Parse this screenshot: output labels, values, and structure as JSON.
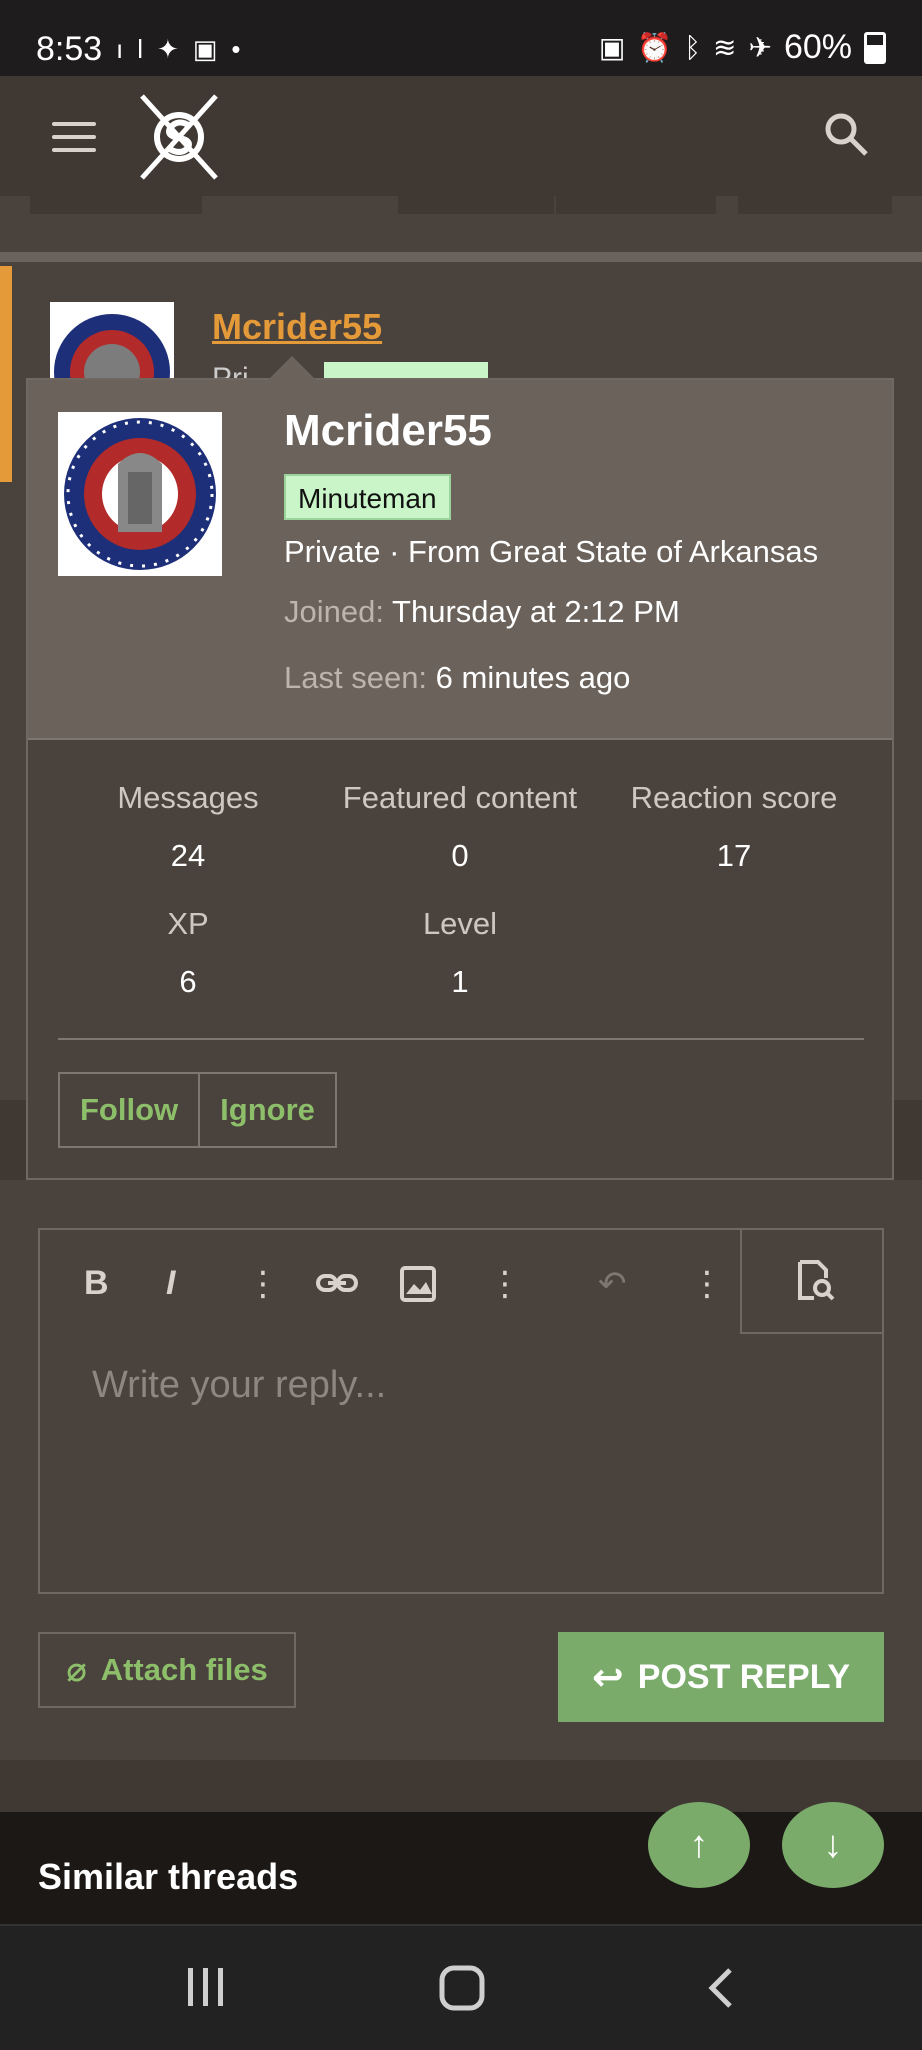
{
  "status_bar": {
    "time": "8:53",
    "battery": "60%",
    "left_icons": [
      "signal-bars-icon",
      "bird-icon",
      "image-icon",
      "dot-icon"
    ],
    "right_icons": [
      "battery-saver-icon",
      "alarm-icon",
      "bluetooth-icon",
      "wifi-icon",
      "airplane-icon"
    ]
  },
  "header": {
    "menu_icon": "hamburger-icon",
    "logo": "site-logo",
    "search_icon": "search-icon"
  },
  "post": {
    "username": "Mcrider55",
    "subtitle": "Pri"
  },
  "popup": {
    "username": "Mcrider55",
    "badge": "Minuteman",
    "rank_location": "Private · From Great State of Arkansas",
    "joined_label": "Joined:",
    "joined_value": "Thursday at 2:12 PM",
    "last_seen_label": "Last seen:",
    "last_seen_value": "6 minutes ago",
    "stats": [
      {
        "label": "Messages",
        "value": "24"
      },
      {
        "label": "Featured content",
        "value": "0"
      },
      {
        "label": "Reaction score",
        "value": "17"
      },
      {
        "label": "XP",
        "value": "6"
      },
      {
        "label": "Level",
        "value": "1"
      }
    ],
    "buttons": {
      "follow": "Follow",
      "ignore": "Ignore"
    }
  },
  "editor": {
    "toolbar": [
      "bold-icon",
      "italic-icon",
      "more-vertical-icon",
      "link-icon",
      "image-icon",
      "more-vertical-icon",
      "undo-icon",
      "more-vertical-icon",
      "preview-icon"
    ],
    "placeholder": "Write your reply..."
  },
  "actions": {
    "attach_files": "Attach files",
    "post_reply": "POST REPLY"
  },
  "similar_threads": {
    "title": "Similar threads"
  },
  "colors": {
    "accent_orange": "#e59a3a",
    "accent_green": "#7aab6a",
    "badge_green": "#c9f5c9"
  }
}
